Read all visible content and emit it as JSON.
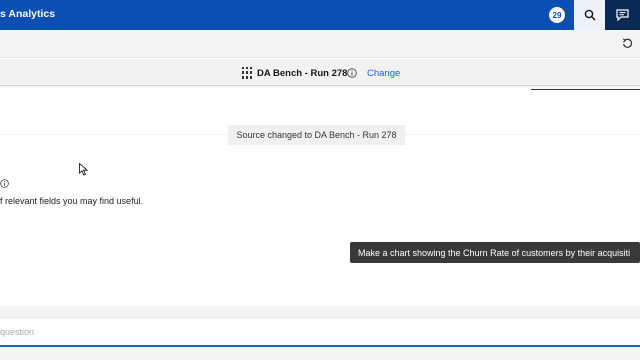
{
  "header": {
    "app_title": "s Analytics",
    "notification_count": "29"
  },
  "source": {
    "name": "DA Bench - Run 278",
    "change_label": "Change"
  },
  "conversation": {
    "system_message": "Source changed to DA Bench - Run 278",
    "assistant_text": "f relevant fields you may find useful."
  },
  "tooltip": {
    "text": "Make a chart showing the Churn Rate of customers by their acquisiti"
  },
  "input": {
    "placeholder": "question"
  },
  "colors": {
    "header_bg": "#0b4fb3",
    "chat_button_bg": "#0a2a55",
    "link": "#0f62fe",
    "tooltip_bg": "#393939"
  },
  "icons": [
    "search-icon",
    "chat-icon",
    "reset-icon",
    "data-source-icon",
    "info-icon"
  ]
}
